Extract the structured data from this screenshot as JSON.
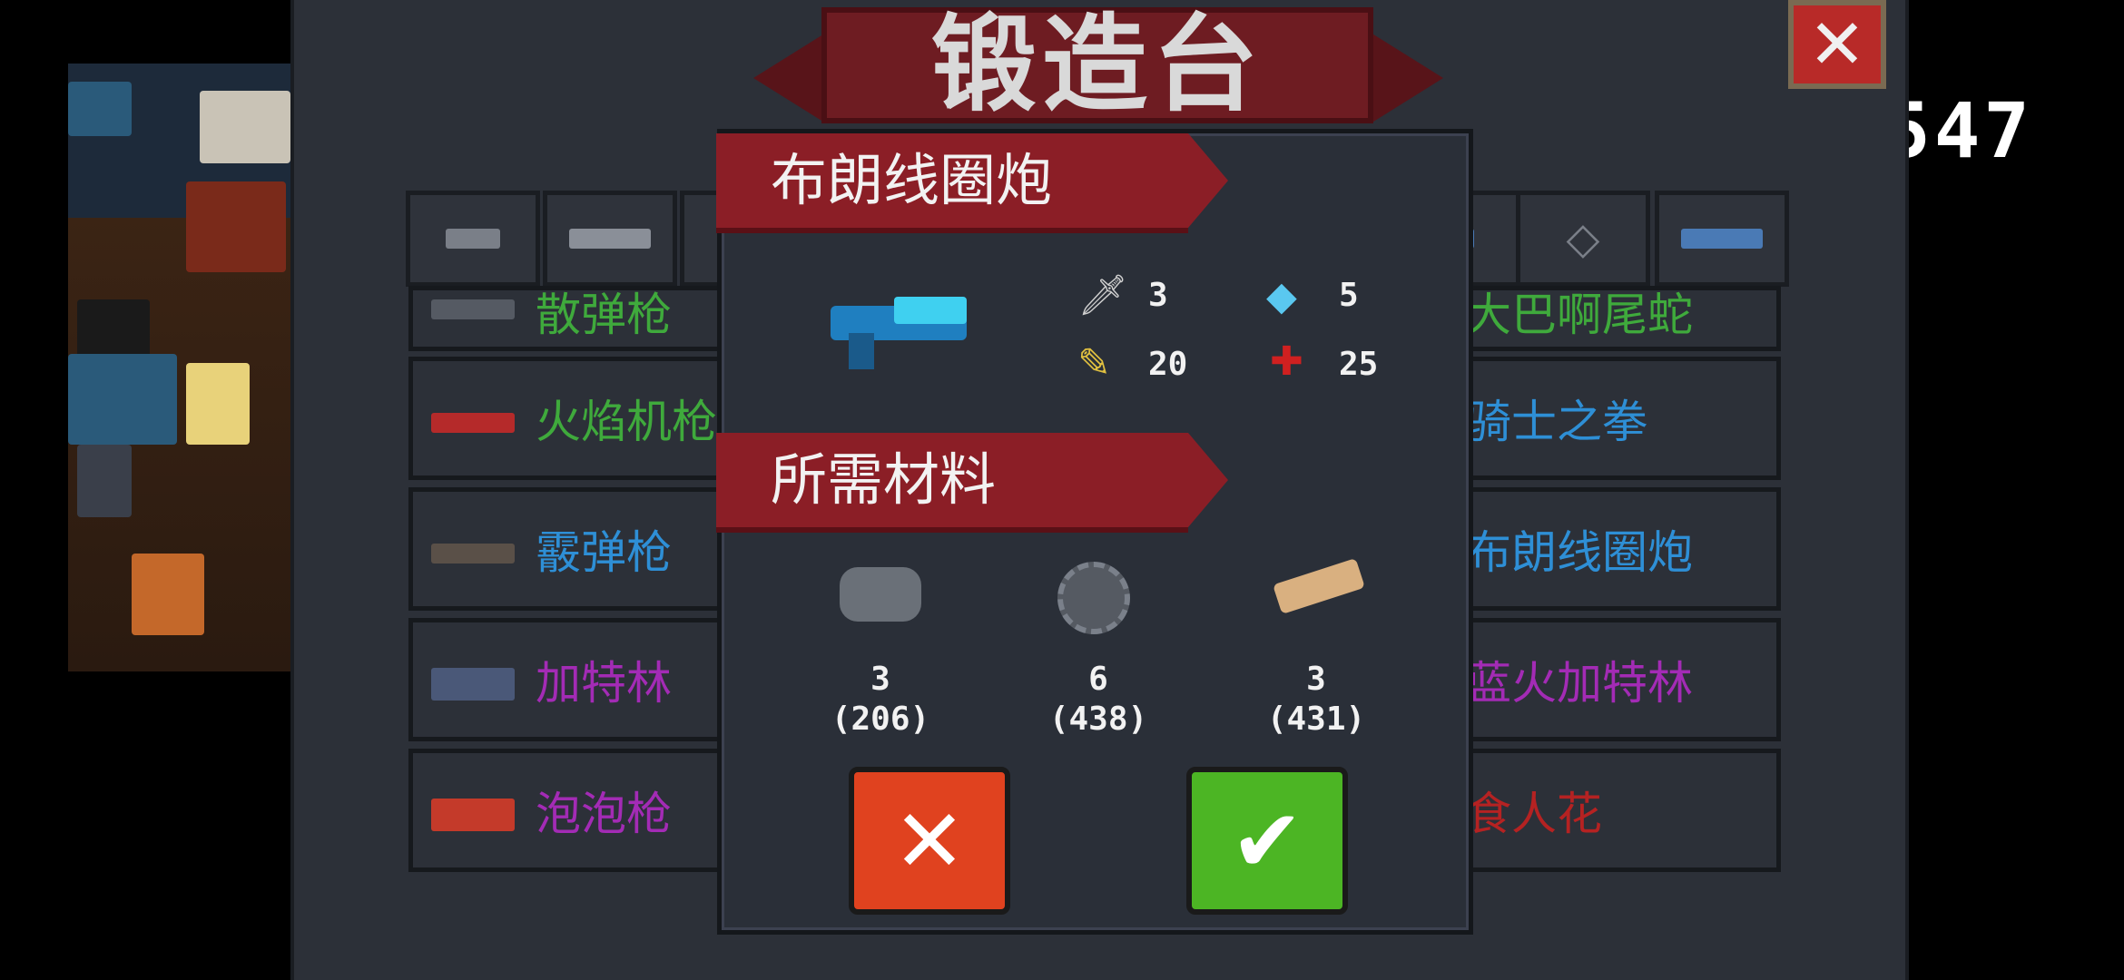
{
  "hud": {
    "coin_count": "547"
  },
  "forge": {
    "title": "锻造台",
    "close_label": "✕"
  },
  "tabs": [
    {
      "name": "pistol"
    },
    {
      "name": "rifle"
    },
    {
      "name": "unknown-3"
    },
    {
      "name": "unknown-hidden"
    },
    {
      "name": "shotgun-small"
    },
    {
      "name": "crosshair"
    },
    {
      "name": "fish-gun"
    }
  ],
  "weapon_rows": [
    {
      "left_name": "散弹枪",
      "right_name": "大巴啊尾蛇",
      "left_color": "#3faa3c",
      "right_color": "#3faa3c"
    },
    {
      "left_name": "火焰机枪",
      "right_name": "骑士之拳",
      "left_color": "#3faa3c",
      "right_color": "#2e8fd6"
    },
    {
      "left_name": "霰弹枪",
      "right_name": "布朗线圈炮",
      "left_color": "#2e8fd6",
      "right_color": "#2e8fd6"
    },
    {
      "left_name": "加特林",
      "right_name": "蓝火加特林",
      "left_color": "#a32bb5",
      "right_color": "#a32bb5"
    },
    {
      "left_name": "泡泡枪",
      "right_name": "食人花",
      "left_color": "#a32bb5",
      "right_color": "#b52222"
    }
  ],
  "dialog": {
    "weapon_name": "布朗线圈炮",
    "stats": {
      "damage": "3",
      "energy": "5",
      "crit": "20",
      "inaccuracy": "25"
    },
    "materials_title": "所需材料",
    "materials": [
      {
        "name": "ore",
        "need": "3",
        "have": "(206)"
      },
      {
        "name": "gear",
        "need": "6",
        "have": "(438)"
      },
      {
        "name": "wood",
        "need": "3",
        "have": "(431)"
      }
    ],
    "cancel_label": "✕",
    "confirm_label": "✔",
    "colors": {
      "cancel": "#e0421f",
      "confirm": "#4cb524"
    }
  }
}
